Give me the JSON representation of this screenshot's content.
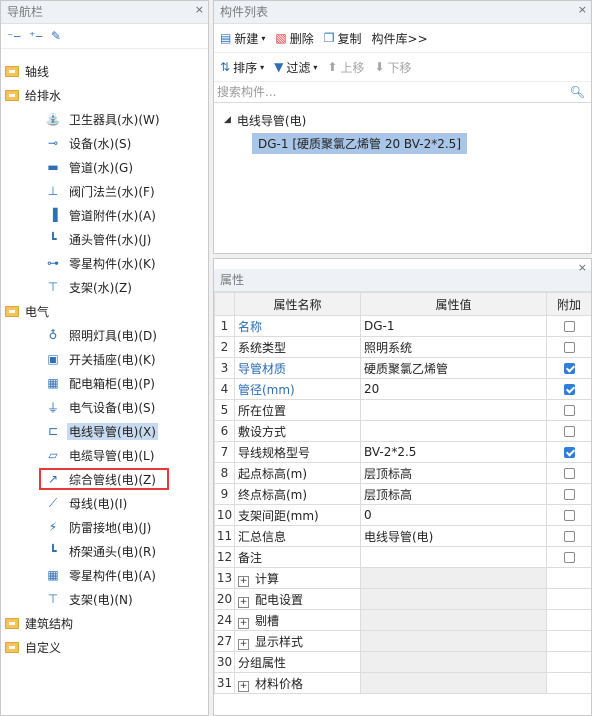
{
  "nav": {
    "title": "导航栏",
    "close": "×",
    "tools": [
      "collapse-icon",
      "expand-icon",
      "edit-icon"
    ],
    "items": [
      {
        "level": 0,
        "type": "folder",
        "label": "轴线"
      },
      {
        "level": 0,
        "type": "folder",
        "label": "给排水"
      },
      {
        "level": 1,
        "icon": "sanitary-icon",
        "label": "卫生器具(水)(W)"
      },
      {
        "level": 1,
        "icon": "equipment-icon",
        "label": "设备(水)(S)"
      },
      {
        "level": 1,
        "icon": "pipe-icon",
        "label": "管道(水)(G)"
      },
      {
        "level": 1,
        "icon": "valve-icon",
        "label": "阀门法兰(水)(F)"
      },
      {
        "level": 1,
        "icon": "pipe-fitting-icon",
        "label": "管道附件(水)(A)"
      },
      {
        "level": 1,
        "icon": "joint-icon",
        "label": "通头管件(水)(J)"
      },
      {
        "level": 1,
        "icon": "part-icon",
        "label": "零星构件(水)(K)"
      },
      {
        "level": 1,
        "icon": "support-icon",
        "label": "支架(水)(Z)"
      },
      {
        "level": 0,
        "type": "folder",
        "label": "电气"
      },
      {
        "level": 1,
        "icon": "lamp-icon",
        "label": "照明灯具(电)(D)"
      },
      {
        "level": 1,
        "icon": "switch-icon",
        "label": "开关插座(电)(K)"
      },
      {
        "level": 1,
        "icon": "cabinet-icon",
        "label": "配电箱柜(电)(P)"
      },
      {
        "level": 1,
        "icon": "electric-equipment-icon",
        "label": "电气设备(电)(S)"
      },
      {
        "level": 1,
        "icon": "conduit-icon",
        "label": "电线导管(电)(X)",
        "selected": true
      },
      {
        "level": 1,
        "icon": "cable-icon",
        "label": "电缆导管(电)(L)"
      },
      {
        "level": 1,
        "icon": "combined-line-icon",
        "label": "综合管线(电)(Z)",
        "highlighted": true
      },
      {
        "level": 1,
        "icon": "busbar-icon",
        "label": "母线(电)(I)"
      },
      {
        "level": 1,
        "icon": "grounding-icon",
        "label": "防雷接地(电)(J)"
      },
      {
        "level": 1,
        "icon": "tray-joint-icon",
        "label": "桥架通头(电)(R)"
      },
      {
        "level": 1,
        "icon": "grid-part-icon",
        "label": "零星构件(电)(A)"
      },
      {
        "level": 1,
        "icon": "support-icon",
        "label": "支架(电)(N)"
      },
      {
        "level": 0,
        "type": "folder",
        "label": "建筑结构"
      },
      {
        "level": 0,
        "type": "folder",
        "label": "自定义"
      }
    ]
  },
  "component_list": {
    "title": "构件列表",
    "close": "×",
    "toolbar1": {
      "new": "新建",
      "delete": "删除",
      "copy": "复制",
      "library": "构件库>>"
    },
    "toolbar2": {
      "sort": "排序",
      "filter": "过滤",
      "up": "上移",
      "down": "下移"
    },
    "search_placeholder": "搜索构件...",
    "group": "电线导管(电)",
    "item": "DG-1 [硬质聚氯乙烯管 20 BV-2*2.5]"
  },
  "properties": {
    "title": "属性",
    "close": "×",
    "headers": {
      "name": "属性名称",
      "value": "属性值",
      "extra": "附加"
    },
    "rows": [
      {
        "num": "1",
        "name": "名称",
        "value": "DG-1",
        "blue": true,
        "check": "off"
      },
      {
        "num": "2",
        "name": "系统类型",
        "value": "照明系统",
        "blue": false,
        "check": "off"
      },
      {
        "num": "3",
        "name": "导管材质",
        "value": "硬质聚氯乙烯管",
        "blue": true,
        "check": "on"
      },
      {
        "num": "4",
        "name": "管径(mm)",
        "value": "20",
        "blue": true,
        "check": "on"
      },
      {
        "num": "5",
        "name": "所在位置",
        "value": "",
        "blue": false,
        "check": "off"
      },
      {
        "num": "6",
        "name": "敷设方式",
        "value": "",
        "blue": false,
        "check": "off"
      },
      {
        "num": "7",
        "name": "导线规格型号",
        "value": "BV-2*2.5",
        "blue": false,
        "check": "on"
      },
      {
        "num": "8",
        "name": "起点标高(m)",
        "value": "层顶标高",
        "blue": false,
        "check": "off"
      },
      {
        "num": "9",
        "name": "终点标高(m)",
        "value": "层顶标高",
        "blue": false,
        "check": "off"
      },
      {
        "num": "10",
        "name": "支架间距(mm)",
        "value": "0",
        "blue": false,
        "check": "off"
      },
      {
        "num": "11",
        "name": "汇总信息",
        "value": "电线导管(电)",
        "blue": false,
        "check": "off"
      },
      {
        "num": "12",
        "name": "备注",
        "value": "",
        "blue": false,
        "check": "off"
      },
      {
        "num": "13",
        "name": "计算",
        "value": "",
        "blue": false,
        "check": "none",
        "expand": true
      },
      {
        "num": "20",
        "name": "配电设置",
        "value": "",
        "blue": false,
        "check": "none",
        "expand": true
      },
      {
        "num": "24",
        "name": "剔槽",
        "value": "",
        "blue": false,
        "check": "none",
        "expand": true
      },
      {
        "num": "27",
        "name": "显示样式",
        "value": "",
        "blue": false,
        "check": "none",
        "expand": true
      },
      {
        "num": "30",
        "name": "分组属性",
        "value": "",
        "blue": false,
        "check": "none",
        "expand": false,
        "group": true
      },
      {
        "num": "31",
        "name": "材料价格",
        "value": "",
        "blue": false,
        "check": "none",
        "expand": true
      }
    ]
  }
}
